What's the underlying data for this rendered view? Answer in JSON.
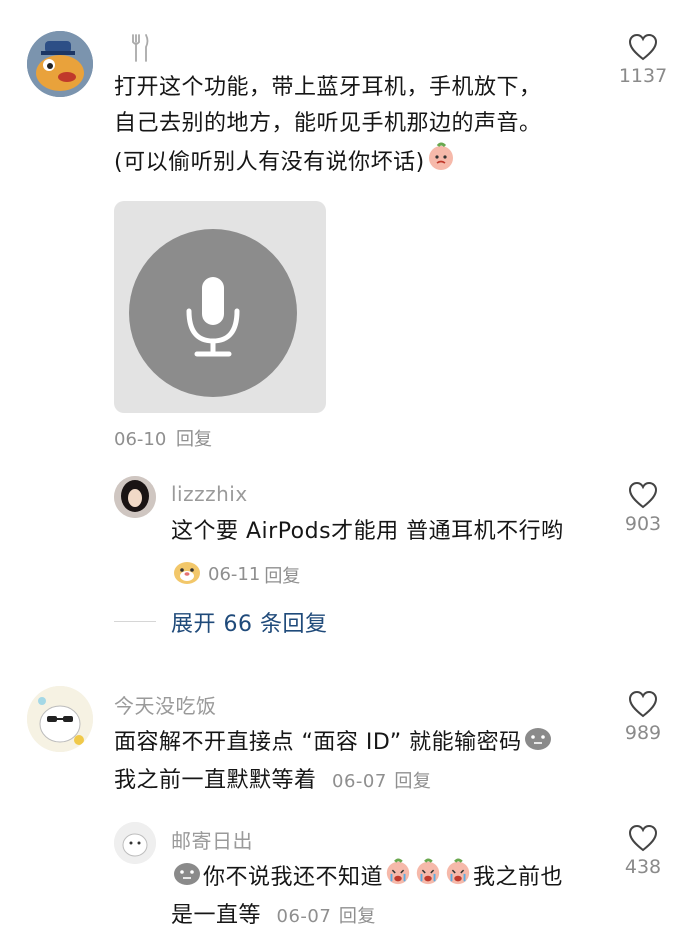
{
  "comment1": {
    "utensil_icon": "fork-knife-icon",
    "lines": [
      "打开这个功能，带上蓝牙耳机，手机放下，",
      "自己去别的地方，能听见手机那边的声音。",
      "(可以偷听别人有没有说你坏话)"
    ],
    "image_icon": "microphone-icon",
    "date": "06-10",
    "reply_label": "回复",
    "likes": "1137"
  },
  "reply1": {
    "username": "lizzzhix",
    "text": "这个要 AirPods才能用 普通耳机不行哟",
    "date": "06-11",
    "reply_label": "回复",
    "likes": "903"
  },
  "expand": {
    "label": "展开 66 条回复"
  },
  "comment2": {
    "username": "今天没吃饭",
    "line1": "面容解不开直接点 “面容 ID” 就能输密码",
    "line2": "我之前一直默默等着",
    "date": "06-07",
    "reply_label": "回复",
    "likes": "989"
  },
  "reply2": {
    "username": "邮寄日出",
    "line1_a": "你不说我还不知道",
    "line1_b": "我之前也",
    "line2": "是一直等",
    "date": "06-07",
    "reply_label": "回复",
    "likes": "438"
  },
  "colors": {
    "blue_link": "#1f4a7a",
    "gray_text": "#8f8f8f",
    "image_bg": "#e3e3e3",
    "mic_circle": "#8c8c8c"
  }
}
